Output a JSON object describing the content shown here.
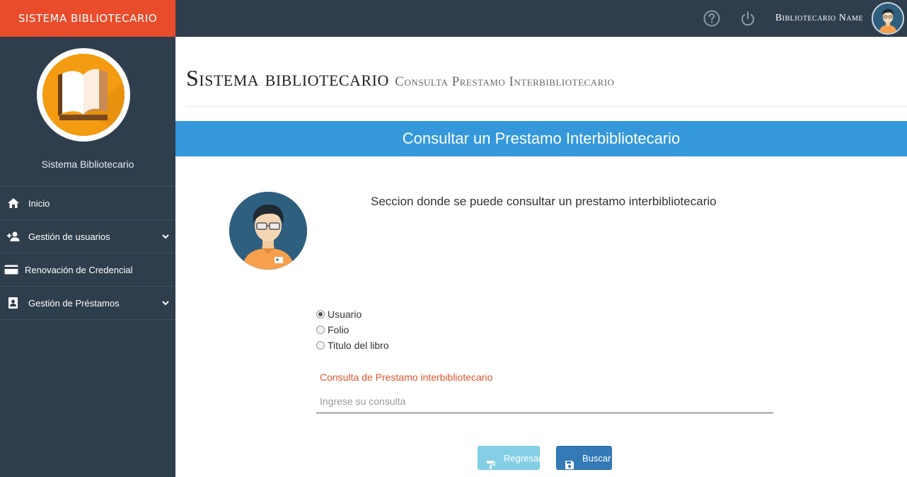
{
  "header": {
    "brand": "SISTEMA BIBLIOTECARIO",
    "help_icon": "help-circle-icon",
    "power_icon": "power-icon",
    "user_name": "Bibliotecario Name"
  },
  "sidebar": {
    "title": "Sistema Bibliotecario",
    "items": [
      {
        "label": "Inicio",
        "icon": "home-icon",
        "has_submenu": false
      },
      {
        "label": "Gestión de usuarios",
        "icon": "user-add-icon",
        "has_submenu": true
      },
      {
        "label": "Renovación de Credencial",
        "icon": "credit-card-icon",
        "has_submenu": false
      },
      {
        "label": "Gestión de Préstamos",
        "icon": "portrait-icon",
        "has_submenu": true
      }
    ]
  },
  "main": {
    "title": "Sistema bibliotecario",
    "subtitle": "Consulta Prestamo Interbibliotecario",
    "panel_heading": "Consultar un Prestamo Interbibliotecario",
    "description": "Seccion donde se puede consultar un prestamo interbibliotecario",
    "search_options": [
      {
        "label": "Usuario",
        "selected": true
      },
      {
        "label": "Folio",
        "selected": false
      },
      {
        "label": "Titulo del libro",
        "selected": false
      }
    ],
    "query_label": "Consulta de Prestamo interbibliotecario",
    "query_placeholder": "Ingrese su consulta",
    "query_value": "",
    "back_button": "Regresar",
    "search_button": "Buscar"
  },
  "colors": {
    "brand": "#e84c2b",
    "topbar": "#2f3e4d",
    "panel_heading": "#3498db",
    "label_accent": "#e0552f",
    "button_info": "#5bc0de",
    "button_primary": "#337ab7"
  }
}
